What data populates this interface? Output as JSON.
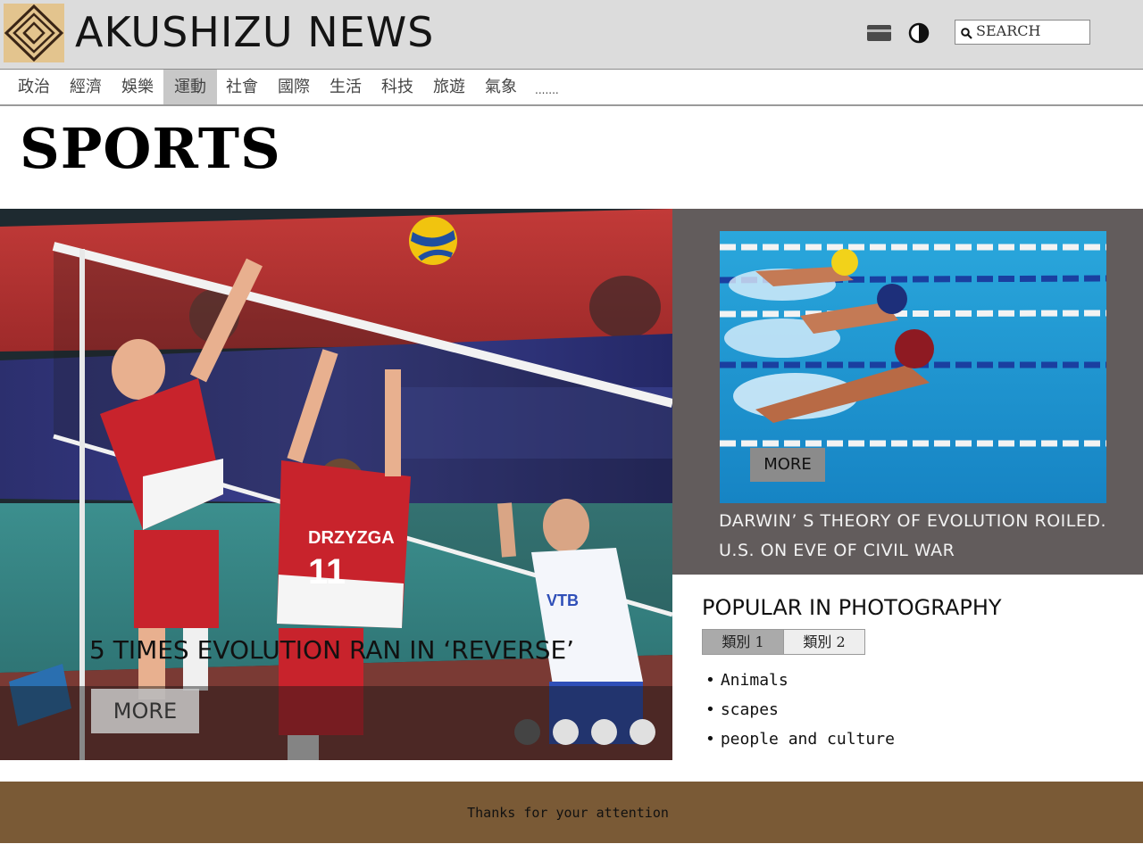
{
  "header": {
    "site_title": "AKUSHIZU NEWS",
    "search_placeholder": "SEARCH"
  },
  "nav": {
    "items": [
      "政治",
      "經濟",
      "娛樂",
      "運動",
      "社會",
      "國際",
      "生活",
      "科技",
      "旅遊",
      "氣象"
    ],
    "active": "運動",
    "more": "......."
  },
  "page": {
    "title": "SPORTS"
  },
  "hero": {
    "headline": "5 TIMES EVOLUTION RAN IN ‘REVERSE’",
    "more_label": "MORE",
    "slide_count": 4,
    "active_slide": 1
  },
  "feature": {
    "more_label": "MORE",
    "headline_line1": "DARWIN’ S THEORY OF EVOLUTION ROILED.",
    "headline_line2": "U.S. ON EVE OF CIVIL WAR"
  },
  "popular": {
    "title": "POPULAR IN PHOTOGRAPHY",
    "tabs": [
      "類別 1",
      "類別 2"
    ],
    "active_tab": "類別 1",
    "items": [
      "Animals",
      "scapes",
      "people and culture"
    ]
  },
  "footer": {
    "text": "Thanks for your attention"
  },
  "colors": {
    "header_bg": "#dcdcdc",
    "feature_bg": "#625c5c",
    "footer_bg": "#7a5a36",
    "logo_bg": "#e3c48e"
  }
}
